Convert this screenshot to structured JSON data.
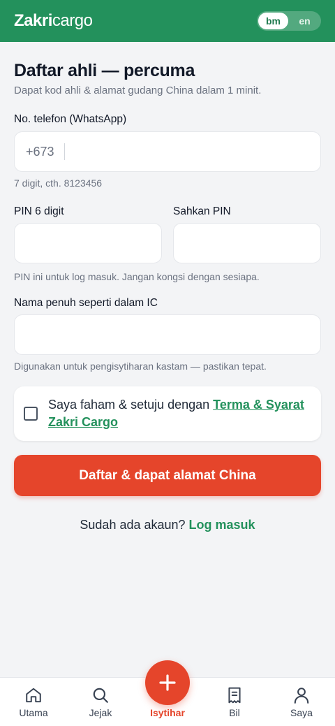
{
  "header": {
    "logo_bold": "Zakri",
    "logo_light": "cargo",
    "lang_options": [
      "bm",
      "en"
    ],
    "lang_selected": "bm"
  },
  "form": {
    "title": "Daftar ahli — percuma",
    "subtitle": "Dapat kod ahli & alamat gudang China dalam 1 minit.",
    "phone": {
      "label": "No. telefon (WhatsApp)",
      "prefix": "+673",
      "hint": "7 digit, cth. 8123456",
      "value": ""
    },
    "pin": {
      "label": "PIN 6 digit",
      "value": ""
    },
    "pin_confirm": {
      "label": "Sahkan PIN",
      "value": ""
    },
    "pin_hint": "PIN ini untuk log masuk. Jangan kongsi dengan sesiapa.",
    "name": {
      "label": "Nama penuh seperti dalam IC",
      "hint": "Digunakan untuk pengisytiharan kastam — pastikan tepat.",
      "value": ""
    },
    "terms": {
      "text": "Saya faham & setuju dengan ",
      "link": "Terma & Syarat Zakri Cargo",
      "checked": false
    },
    "submit_label": "Daftar & dapat alamat China",
    "login_prompt": "Sudah ada akaun? ",
    "login_link": "Log masuk"
  },
  "bottom_nav": [
    {
      "label": "Utama",
      "icon": "home-icon"
    },
    {
      "label": "Jejak",
      "icon": "search-icon"
    },
    {
      "label": "Isytihar",
      "icon": "plus-icon"
    },
    {
      "label": "Bil",
      "icon": "receipt-icon"
    },
    {
      "label": "Saya",
      "icon": "user-icon"
    }
  ],
  "colors": {
    "brand_green": "#23915c",
    "accent_red": "#e5452b",
    "background": "#f3f4f6"
  }
}
